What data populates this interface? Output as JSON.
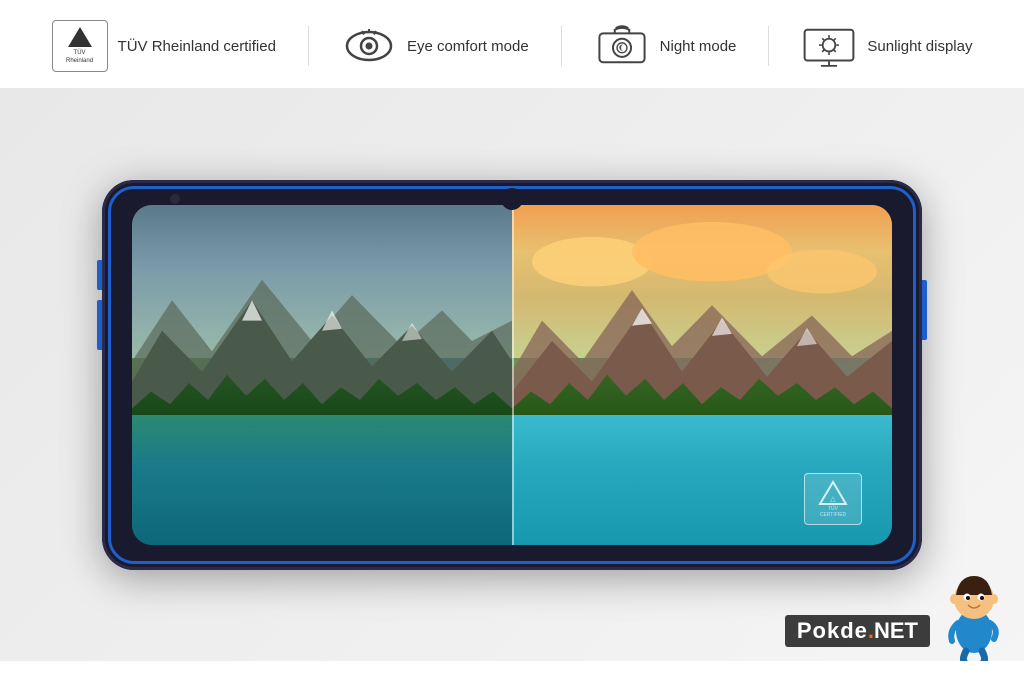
{
  "features": [
    {
      "id": "tuv",
      "label": "TÜV Rheinland certified",
      "icon_type": "tuv",
      "icon_name": "tuv-certified-icon"
    },
    {
      "id": "eye",
      "label": "Eye comfort mode",
      "icon_type": "eye",
      "icon_name": "eye-comfort-icon"
    },
    {
      "id": "night",
      "label": "Night mode",
      "icon_type": "night",
      "icon_name": "night-mode-icon"
    },
    {
      "id": "sunlight",
      "label": "Sunlight display",
      "icon_type": "sun",
      "icon_name": "sunlight-display-icon"
    }
  ],
  "phone": {
    "screen": {
      "left_mode": "eye_comfort",
      "right_mode": "normal"
    }
  },
  "branding": {
    "site_name": "Pokde",
    "site_domain": "Pokde.NET",
    "site_tld": ".NET"
  }
}
